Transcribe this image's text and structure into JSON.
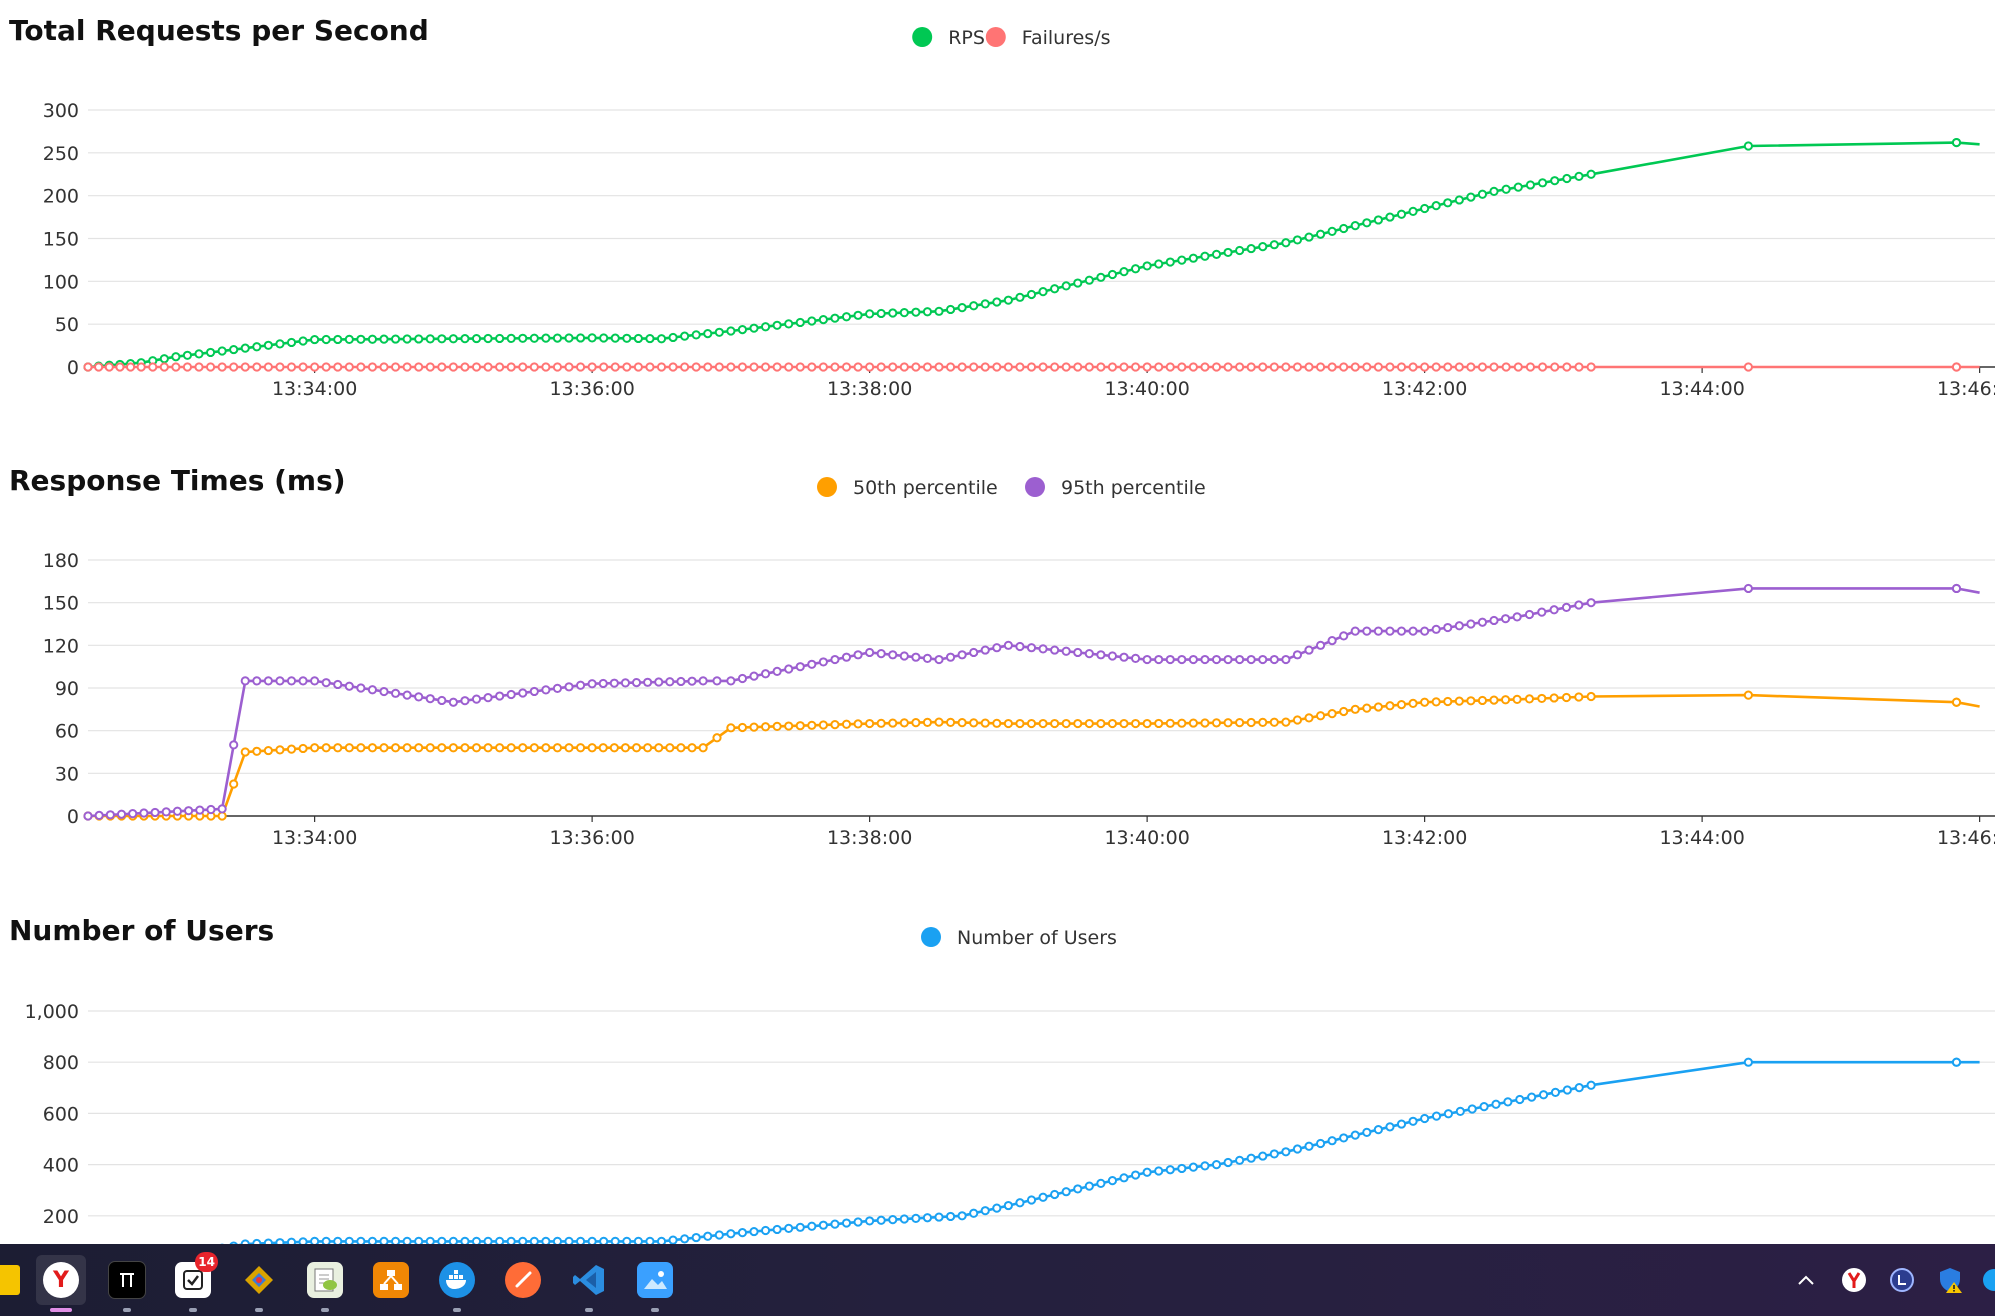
{
  "chart_data": [
    {
      "type": "line",
      "title": "Total Requests per Second",
      "x": [
        "13:32:22",
        "13:32:45",
        "13:33:00",
        "13:33:30",
        "13:34:00",
        "13:35:00",
        "13:36:00",
        "13:36:30",
        "13:37:00",
        "13:38:00",
        "13:38:30",
        "13:39:00",
        "13:40:00",
        "13:41:00",
        "13:42:00",
        "13:42:30",
        "13:43:12",
        "13:44:20",
        "13:45:50",
        "13:46:00"
      ],
      "series": [
        {
          "name": "RPS",
          "color": "#00c853",
          "values": [
            0,
            5,
            12,
            22,
            32,
            33,
            34,
            33,
            42,
            62,
            65,
            78,
            118,
            145,
            185,
            205,
            225,
            258,
            262,
            260
          ]
        },
        {
          "name": "Failures/s",
          "color": "#ff7474",
          "values": [
            0,
            0,
            0,
            0,
            0,
            0,
            0,
            0,
            0,
            0,
            0,
            0,
            0,
            0,
            0,
            0,
            0,
            0,
            0,
            0
          ]
        }
      ],
      "ylim": [
        0,
        300
      ],
      "yticks": [
        "0",
        "50",
        "100",
        "150",
        "200",
        "250",
        "300"
      ],
      "xticks": [
        "13:34:00",
        "13:36:00",
        "13:38:00",
        "13:40:00",
        "13:42:00",
        "13:44:00",
        "13:46:00"
      ],
      "grid": true,
      "legend": "top-center"
    },
    {
      "type": "line",
      "title": "Response Times (ms)",
      "x": [
        "13:32:22",
        "13:33:20",
        "13:33:30",
        "13:34:00",
        "13:35:00",
        "13:36:00",
        "13:36:48",
        "13:37:00",
        "13:38:00",
        "13:38:30",
        "13:39:00",
        "13:40:00",
        "13:41:00",
        "13:41:30",
        "13:42:00",
        "13:42:40",
        "13:43:12",
        "13:44:20",
        "13:45:50",
        "13:46:00"
      ],
      "series": [
        {
          "name": "50th percentile",
          "color": "#ff9f00",
          "values": [
            0,
            0,
            45,
            48,
            48,
            48,
            48,
            62,
            65,
            66,
            65,
            65,
            66,
            75,
            80,
            82,
            84,
            85,
            80,
            77
          ]
        },
        {
          "name": "95th percentile",
          "color": "#9c5fd0",
          "values": [
            0,
            5,
            95,
            95,
            80,
            93,
            95,
            95,
            115,
            110,
            120,
            110,
            110,
            130,
            130,
            140,
            150,
            160,
            160,
            157
          ]
        }
      ],
      "ylim": [
        0,
        180
      ],
      "yticks": [
        "0",
        "30",
        "60",
        "90",
        "120",
        "150",
        "180"
      ],
      "xticks": [
        "13:34:00",
        "13:36:00",
        "13:38:00",
        "13:40:00",
        "13:42:00",
        "13:44:00",
        "13:46:00"
      ],
      "grid": true,
      "legend": "top-center"
    },
    {
      "type": "line",
      "title": "Number of Users",
      "x": [
        "13:32:22",
        "13:33:00",
        "13:33:30",
        "13:34:00",
        "13:36:00",
        "13:36:30",
        "13:37:00",
        "13:38:00",
        "13:38:40",
        "13:39:00",
        "13:40:00",
        "13:40:30",
        "13:41:00",
        "13:42:00",
        "13:43:12",
        "13:44:20",
        "13:45:50",
        "13:46:00"
      ],
      "series": [
        {
          "name": "Number of Users",
          "color": "#1aa1f2",
          "values": [
            0,
            40,
            90,
            100,
            100,
            100,
            130,
            180,
            200,
            240,
            370,
            400,
            450,
            580,
            710,
            800,
            800,
            800
          ]
        }
      ],
      "ylim": [
        0,
        1000
      ],
      "yticks": [
        "200",
        "400",
        "600",
        "800",
        "1,000"
      ],
      "grid": true,
      "legend": "top-center"
    }
  ],
  "taskbar": {
    "apps": [
      {
        "name": "file-explorer",
        "active": false,
        "icon_color": "#f5c400"
      },
      {
        "name": "yandex-browser",
        "active": true,
        "icon_color": "#ffffff"
      },
      {
        "name": "terminal",
        "active": false,
        "icon_color": "#111111"
      },
      {
        "name": "todo-app",
        "active": false,
        "icon_color": "#ffffff",
        "badge": "14"
      },
      {
        "name": "git-app",
        "active": false,
        "icon_color": "#d9a300"
      },
      {
        "name": "notepad-plus-plus",
        "active": false,
        "icon_color": "#90c542"
      },
      {
        "name": "drawio",
        "active": false,
        "icon_color": "#f08705"
      },
      {
        "name": "docker",
        "active": false,
        "icon_color": "#1d91e6"
      },
      {
        "name": "postman",
        "active": false,
        "icon_color": "#ff6c37"
      },
      {
        "name": "vscode",
        "active": false,
        "icon_color": "#2b8de0"
      },
      {
        "name": "photos",
        "active": false,
        "icon_color": "#3aa0ff"
      }
    ],
    "tray": [
      "chevron-up-icon",
      "yandex-tray-icon",
      "clock-app-icon",
      "defender-warning-icon",
      "network-icon"
    ]
  }
}
